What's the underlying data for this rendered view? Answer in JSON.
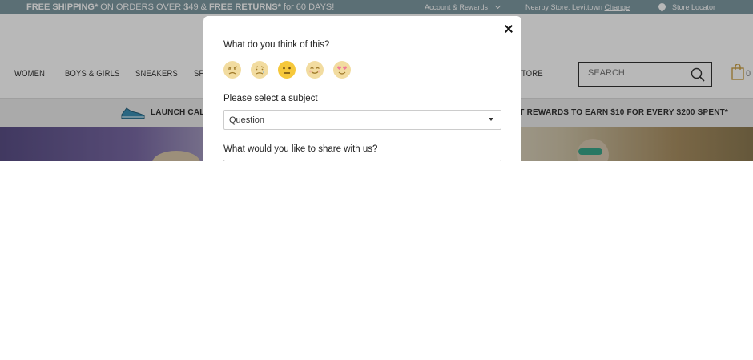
{
  "promo": {
    "shipping_bold": "FREE SHIPPING*",
    "shipping_rest": " ON ORDERS OVER $49 & ",
    "returns_bold": "FREE RETURNS*",
    "returns_rest": " for 60 DAYS!"
  },
  "top_links": {
    "account": "Account & Rewards",
    "nearby_store_label": "Nearby Store: Levittown ",
    "change": "Change",
    "store_locator": "Store Locator"
  },
  "nav": {
    "items": [
      "WOMEN",
      "BOYS & GIRLS",
      "SNEAKERS",
      "SP",
      "TORE"
    ]
  },
  "search": {
    "placeholder": "SEARCH"
  },
  "bag": {
    "count": "0"
  },
  "banner": {
    "launch_label": "LAUNCH CALE",
    "rewards_label": "TT REWARDS TO EARN $10 FOR EVERY $200 SPENT*"
  },
  "modal": {
    "question_rating": "What do you think of this?",
    "emojis": [
      "angry-face",
      "sad-face",
      "neutral-face",
      "smiling-face",
      "heart-eyes-face"
    ],
    "selected_emoji": "neutral-face",
    "subject_label": "Please select a subject",
    "subject_value": "Question",
    "share_label": "What would you like to share with us?"
  },
  "colors": {
    "promo_bar": "#7f9aa3",
    "emoji_inactive": "#f2dca0",
    "emoji_active": "#f6c83b"
  }
}
